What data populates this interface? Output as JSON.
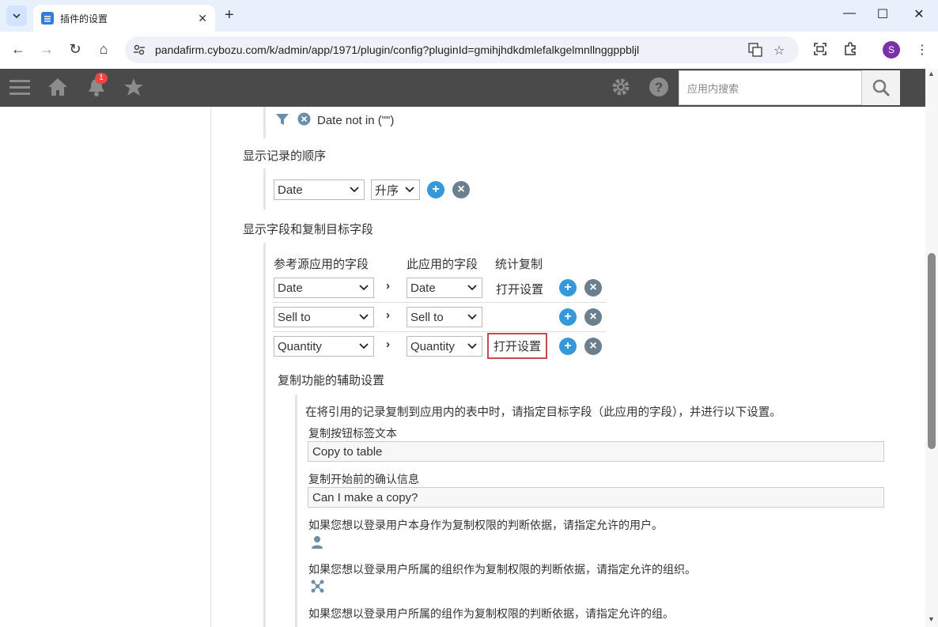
{
  "browser": {
    "tab_title": "插件的设置",
    "url": "pandafirm.cybozu.com/k/admin/app/1971/plugin/config?pluginId=gmihjhdkdmlefalkgelmnllnggppbljl",
    "avatar_letter": "S"
  },
  "app_header": {
    "notification_count": "1",
    "search_placeholder": "应用内搜索"
  },
  "filter": {
    "condition_text": "Date not in (\"\")"
  },
  "sort_section": {
    "title": "显示记录的顺序",
    "field_value": "Date",
    "order_value": "升序"
  },
  "fields_section": {
    "title": "显示字段和复制目标字段",
    "columns": [
      "参考源应用的字段",
      "此应用的字段",
      "统计复制"
    ],
    "rows": [
      {
        "source": "Date",
        "target": "Date",
        "action": "打开设置"
      },
      {
        "source": "Sell to",
        "target": "Sell to",
        "action": ""
      },
      {
        "source": "Quantity",
        "target": "Quantity",
        "action": "打开设置"
      }
    ]
  },
  "aux_section": {
    "title": "复制功能的辅助设置",
    "description": "在将引用的记录复制到应用内的表中时，请指定目标字段（此应用的字段），并进行以下设置。",
    "button_label_caption": "复制按钮标签文本",
    "button_label_value": "Copy to table",
    "confirm_caption": "复制开始前的确认信息",
    "confirm_value": "Can I make a copy?",
    "user_perm_text": "如果您想以登录用户本身作为复制权限的判断依据，请指定允许的用户。",
    "org_perm_text": "如果您想以登录用户所属的组织作为复制权限的判断依据，请指定允许的组织。",
    "group_perm_text": "如果您想以登录用户所属的组作为复制权限的判断依据，请指定允许的组。"
  },
  "colors": {
    "header_bg": "#4a4a4a",
    "plus_button": "#3498db",
    "remove_button": "#6b7f8e",
    "highlight_border": "#c94a4a"
  }
}
